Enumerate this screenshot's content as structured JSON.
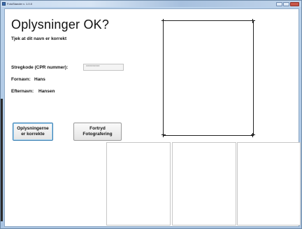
{
  "window": {
    "title": "FotoStander v. 1.0.0",
    "controls": [
      "minimize",
      "maximize",
      "close"
    ]
  },
  "header": {
    "title": "Oplysninger OK?",
    "subtitle": "Tjek at dit navn er korrekt"
  },
  "form": {
    "barcode_label": "Stregkode (CPR nummer):",
    "barcode_value": "**********",
    "firstname_label": "Fornavn:",
    "firstname_value": "Hans",
    "lastname_label": "Efternavn:",
    "lastname_value": "Hansen"
  },
  "actions": {
    "confirm_label": "Oplysningerne\ner korrekte",
    "cancel_label": "Fortryd\nFotografering"
  },
  "icons": {
    "app": "app-icon",
    "corner": "crop-corner-icon"
  },
  "colors": {
    "window_frame": "#b9d1ea",
    "content_bg": "#ffffff",
    "confirm_focus": "#3c7fb1",
    "close_button": "#c9584a"
  }
}
